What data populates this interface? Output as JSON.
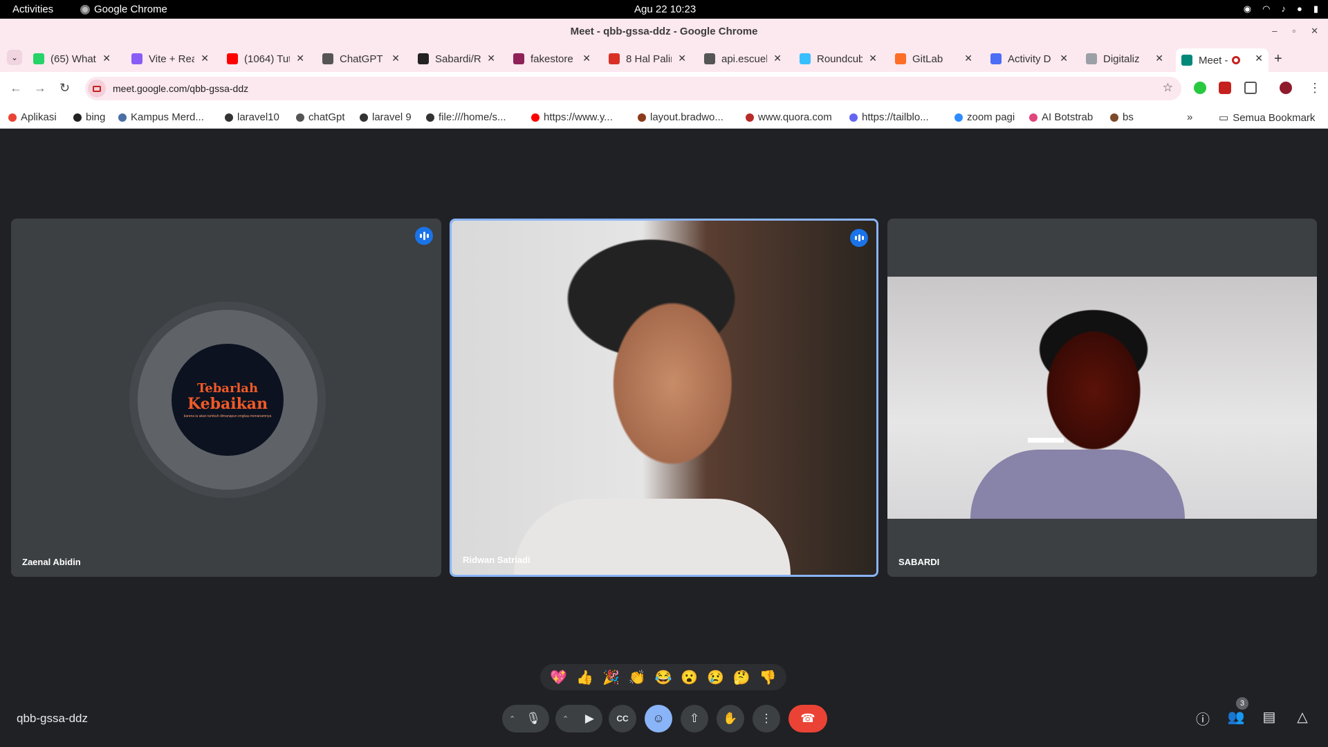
{
  "os": {
    "activities": "Activities",
    "app_name": "Google Chrome",
    "clock": "Agu 22  10:23"
  },
  "window": {
    "title": "Meet - qbb-gssa-ddz - Google Chrome"
  },
  "tabs": [
    {
      "label": "(65) What",
      "color": "#25d366"
    },
    {
      "label": "Vite + Rea",
      "color": "#8a5cf6"
    },
    {
      "label": "(1064) Tut",
      "color": "#ff0000"
    },
    {
      "label": "ChatGPT",
      "color": "#555555"
    },
    {
      "label": "Sabardi/R",
      "color": "#222222"
    },
    {
      "label": "fakestore",
      "color": "#8e2157"
    },
    {
      "label": "8 Hal Palin",
      "color": "#d93025"
    },
    {
      "label": "api.escuel",
      "color": "#555555"
    },
    {
      "label": "Roundcub",
      "color": "#37beff"
    },
    {
      "label": "GitLab",
      "color": "#fc6d26"
    },
    {
      "label": "Activity D",
      "color": "#4c6ef5"
    },
    {
      "label": "Digitaliz",
      "color": "#9aa0a6"
    },
    {
      "label": "Meet -",
      "color": "#00897b",
      "active": true
    }
  ],
  "address": {
    "url": "meet.google.com/qbb-gssa-ddz"
  },
  "bookmarks": [
    {
      "label": "Aplikasi",
      "color": "#ea4335"
    },
    {
      "label": "bing",
      "color": "#222222"
    },
    {
      "label": "Kampus Merd...",
      "color": "#4a6fa5"
    },
    {
      "label": "laravel10",
      "color": "#333333"
    },
    {
      "label": "chatGpt",
      "color": "#555555"
    },
    {
      "label": "laravel 9",
      "color": "#333333"
    },
    {
      "label": "file:///home/s...",
      "color": "#333333"
    },
    {
      "label": "https://www.y...",
      "color": "#ff0000"
    },
    {
      "label": "layout.bradwo...",
      "color": "#8b3a1c"
    },
    {
      "label": "www.quora.com",
      "color": "#b92b27"
    },
    {
      "label": "https://tailblo...",
      "color": "#6366f1"
    },
    {
      "label": "zoom pagi",
      "color": "#2d8cff"
    },
    {
      "label": "AI Botstrab",
      "color": "#e0457b"
    },
    {
      "label": "bs",
      "color": "#7a4a2a"
    }
  ],
  "bookmarks_overflow": "»",
  "all_bookmarks": "Semua Bookmark",
  "participants": [
    {
      "name": "Zaenal Abidin",
      "speaking": true
    },
    {
      "name": "Ridwan Satriadi",
      "speaking": true,
      "active": true
    },
    {
      "name": "SABARDI",
      "speaking": false
    }
  ],
  "avatar_text": {
    "line1": "Tebarlah",
    "line2": "Kebaikan",
    "line3": "karena ia akan tumbuh dimanapun engkau menanamnya"
  },
  "reactions": [
    "💖",
    "👍",
    "🎉",
    "👏",
    "😂",
    "😮",
    "😢",
    "🤔",
    "👎"
  ],
  "meeting_code": "qbb-gssa-ddz",
  "people_count": "3",
  "colors": {
    "stage_bg": "#202124",
    "tile_bg": "#3c4043",
    "accent": "#8ab4f8",
    "end_call": "#ea4335"
  }
}
